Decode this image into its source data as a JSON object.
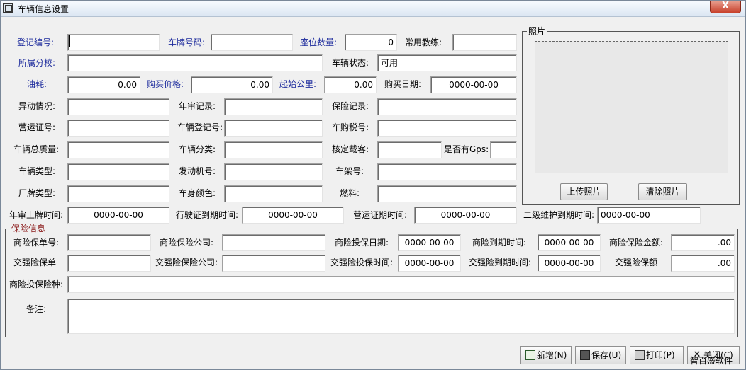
{
  "window": {
    "title": "车辆信息设置",
    "close_label": "X"
  },
  "labels": {
    "reg_no": "登记编号:",
    "plate": "车牌号码:",
    "seats": "座位数量:",
    "coach": "常用教练:",
    "branch": "所属分校:",
    "status": "车辆状态:",
    "fuel": "油耗:",
    "price": "购买价格:",
    "start_km": "起始公里:",
    "buy_date": "购买日期:",
    "change": "异动情况:",
    "inspection": "年审记录:",
    "insurance_rec": "保险记录:",
    "op_cert": "营运证号:",
    "veh_reg_no": "车辆登记号:",
    "tax_no": "车购税号:",
    "total_mass": "车辆总质量:",
    "classification": "车辆分类:",
    "capacity": "核定载客:",
    "gps": "是否有Gps:",
    "veh_type": "车辆类型:",
    "engine": "发动机号:",
    "frame": "车架号:",
    "brand_type": "厂牌类型:",
    "color": "车身颜色:",
    "fuel_type": "燃料:",
    "insp_expiry": "年审上牌时间:",
    "license_expiry": "行驶证到期时间:",
    "op_expiry": "营运证期时间:",
    "maint_expiry": "二级维护到期时间:"
  },
  "values": {
    "reg_no": "",
    "plate": "",
    "seats": "0",
    "coach": "",
    "branch": "",
    "status": "可用",
    "fuel": "0.00",
    "price": "0.00",
    "start_km": "0.00",
    "buy_date": "0000-00-00",
    "change": "",
    "inspection": "",
    "insurance_rec": "",
    "op_cert": "",
    "veh_reg_no": "",
    "tax_no": "",
    "total_mass": "",
    "classification": "",
    "capacity": "",
    "gps": "",
    "veh_type": "",
    "engine": "",
    "frame": "",
    "brand_type": "",
    "color": "",
    "fuel_type": "",
    "insp_expiry": "0000-00-00",
    "license_expiry": "0000-00-00",
    "op_expiry": "0000-00-00",
    "maint_expiry": "0000-00-00"
  },
  "photo": {
    "caption": "照片",
    "upload": "上传照片",
    "clear": "清除照片"
  },
  "insurance": {
    "caption": "保险信息",
    "labels": {
      "com_policy": "商险保单号:",
      "com_company": "商险保险公司:",
      "com_date": "商险投保日期:",
      "com_expiry": "商险到期时间:",
      "com_amount": "商险保险金额:",
      "cmp_policy": "交强险保单",
      "cmp_company": "交强险保险公司:",
      "cmp_date": "交强险投保时间:",
      "cmp_expiry": "交强险到期时间:",
      "cmp_amount": "交强险保额",
      "com_kind": "商险投保险种:"
    },
    "values": {
      "com_policy": "",
      "com_company": "",
      "com_date": "0000-00-00",
      "com_expiry": "0000-00-00",
      "com_amount": ".00",
      "cmp_policy": "",
      "cmp_company": "",
      "cmp_date": "0000-00-00",
      "cmp_expiry": "0000-00-00",
      "cmp_amount": ".00",
      "com_kind": ""
    }
  },
  "remarks": {
    "label": "备注:",
    "value": ""
  },
  "footer": {
    "add": "新增(N)",
    "save": "保存(U)",
    "print": "打印(P)",
    "close": "关闭(C)"
  },
  "watermark": "智百盛软件",
  "colors": {
    "label_blue": "#1c2a9c",
    "insurance_caption": "#8b1a1a"
  }
}
